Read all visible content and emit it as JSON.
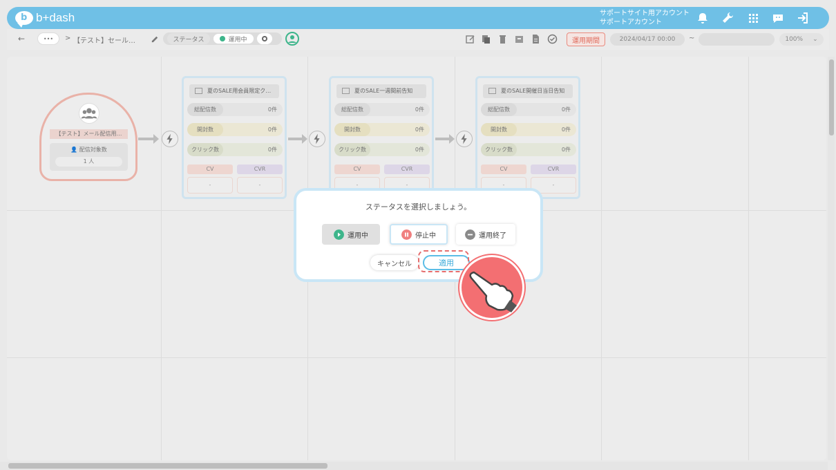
{
  "header": {
    "logo_mark": "b",
    "logo_text": "b+dash",
    "account_line1": "サポートサイト用アカウント",
    "account_line2": "サポートアカウント",
    "brand_color": "#6fc0e6"
  },
  "toolbar": {
    "back_arrow": "←",
    "more_label": "•••",
    "breadcrumb_sep": ">",
    "breadcrumb_title": "【テスト】セール…",
    "status_label": "ステータス",
    "status_value": "運用中",
    "period_label": "運用期間",
    "start_date": "2024/04/17 00:00",
    "date_sep": "~",
    "zoom": "100%"
  },
  "flow": {
    "start": {
      "title": "【テスト】メール配信用…",
      "target_label": "配信対象数",
      "target_count": "1 人"
    },
    "stat_labels": {
      "sent": "総配信数",
      "opened": "開封数",
      "clicked": "クリック数"
    },
    "cv_label": "CV",
    "cvr_label": "CVR",
    "mails": [
      {
        "title": "夏のSALE用会員限定ク…",
        "sent": "0件",
        "opened": "0件",
        "clicked": "0件",
        "cv": "-",
        "cvr": "-"
      },
      {
        "title": "夏のSALE一週間前告知",
        "sent": "0件",
        "opened": "0件",
        "clicked": "0件",
        "cv": "-",
        "cvr": "-"
      },
      {
        "title": "夏のSALE開催日当日告知",
        "sent": "0件",
        "opened": "0件",
        "clicked": "0件",
        "cv": "-",
        "cvr": "-"
      }
    ]
  },
  "modal": {
    "title": "ステータスを選択しましょう。",
    "options": [
      {
        "label": "運用中",
        "color": "#3db58b"
      },
      {
        "label": "停止中",
        "color": "#f07f7f"
      },
      {
        "label": "運用終了",
        "color": "#8a8a8a"
      }
    ],
    "selected": "運用中",
    "cancel_label": "キャンセル",
    "apply_label": "適用"
  }
}
